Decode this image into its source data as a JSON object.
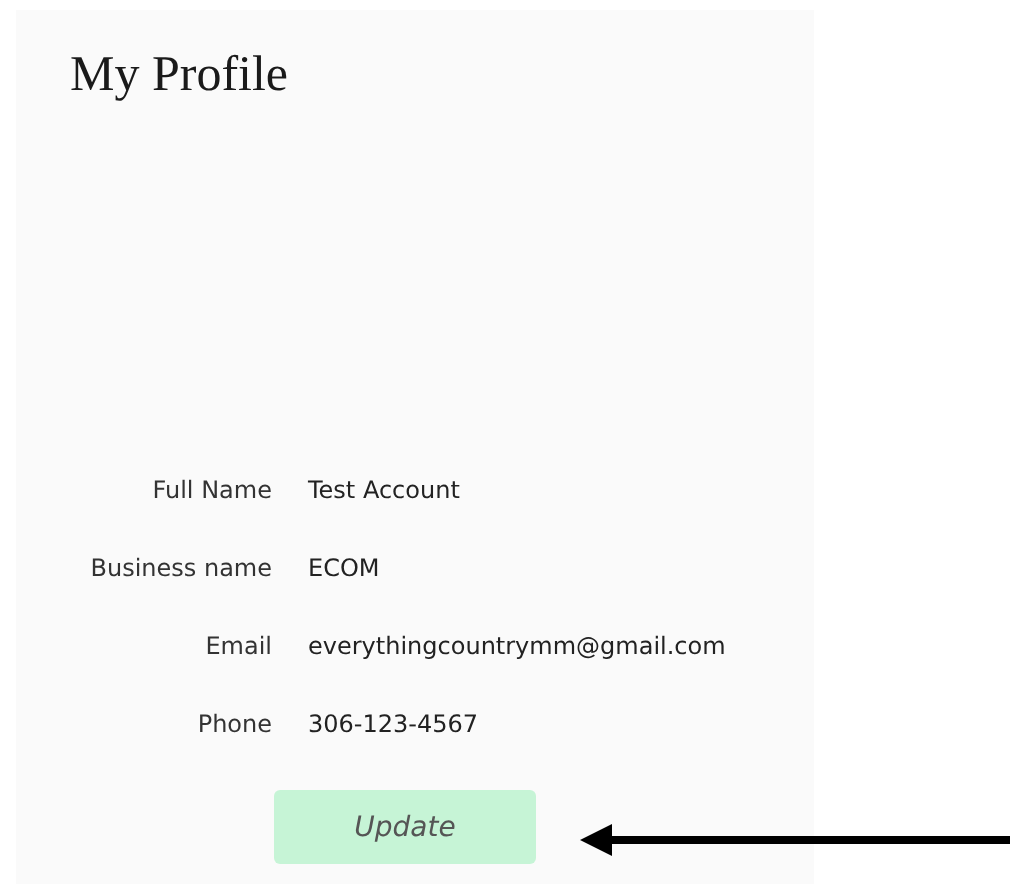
{
  "title": "My Profile",
  "fields": [
    {
      "label": "Full Name",
      "value": "Test Account"
    },
    {
      "label": "Business name",
      "value": "ECOM"
    },
    {
      "label": "Email",
      "value": "everythingcountrymm@gmail.com"
    },
    {
      "label": "Phone",
      "value": "306-123-4567"
    }
  ],
  "button": "Update"
}
